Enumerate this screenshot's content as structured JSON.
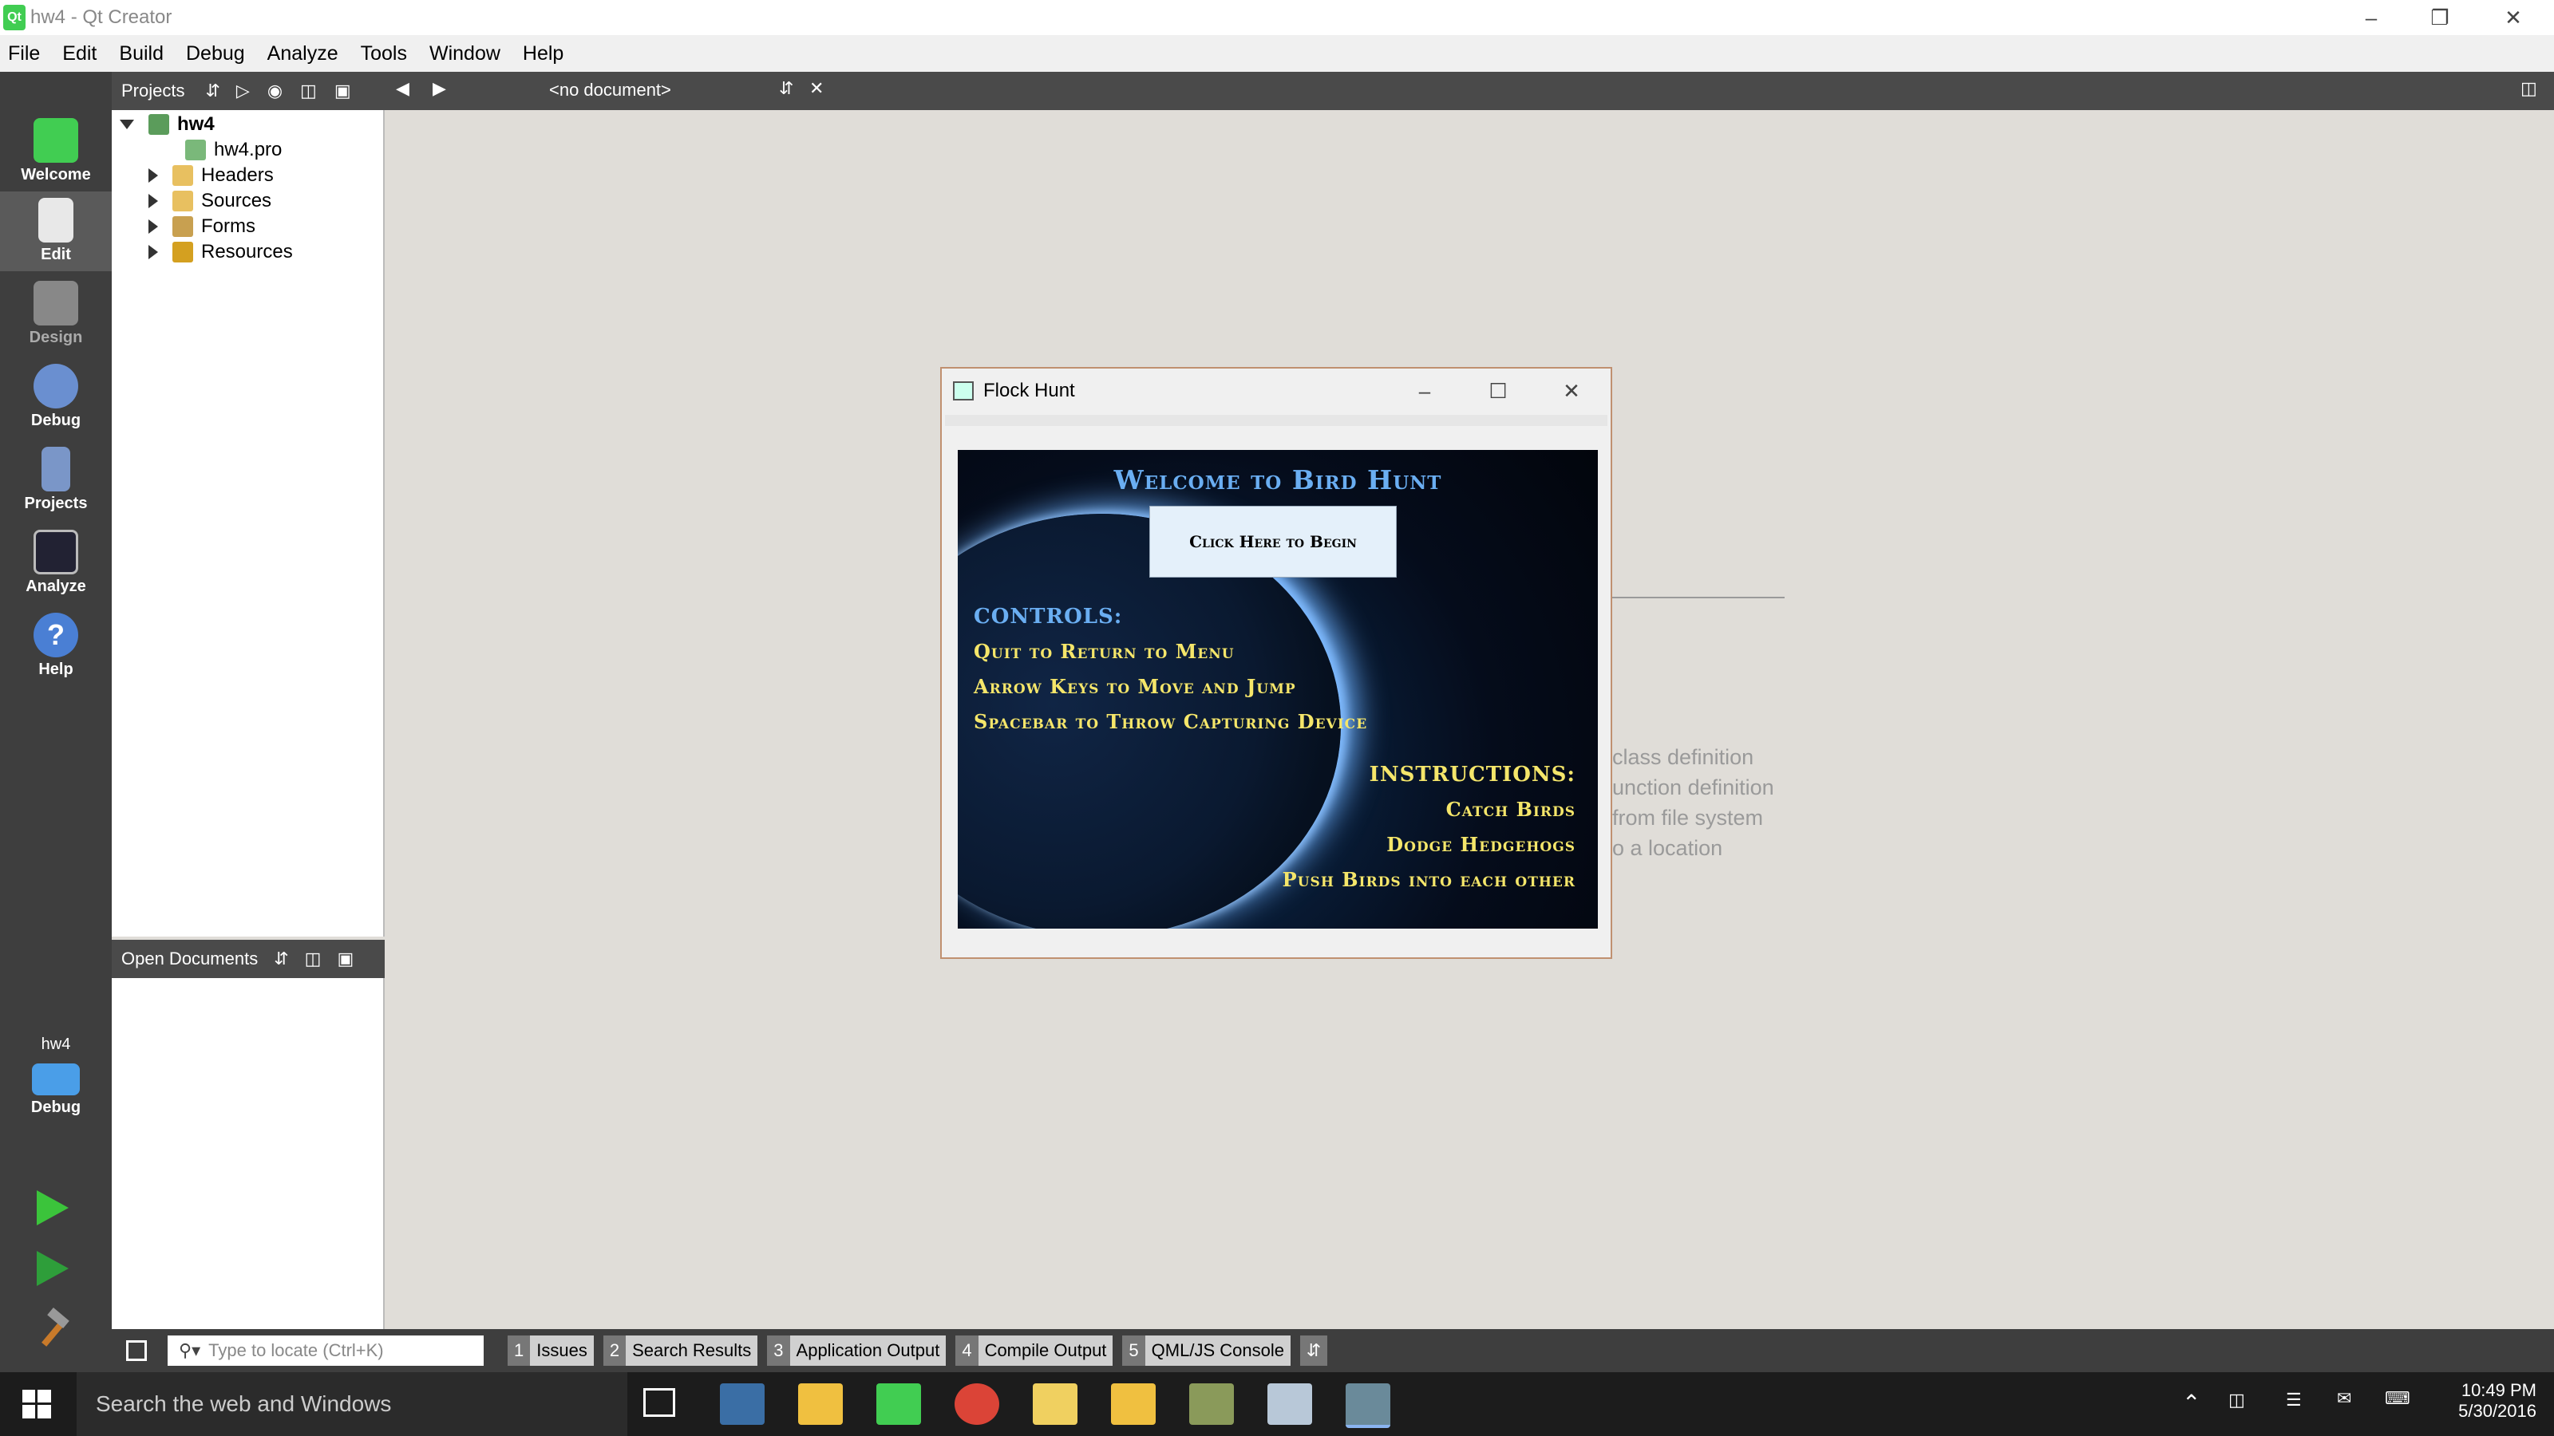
{
  "window": {
    "title": "hw4 - Qt Creator"
  },
  "menu": [
    "File",
    "Edit",
    "Build",
    "Debug",
    "Analyze",
    "Tools",
    "Window",
    "Help"
  ],
  "modes": [
    {
      "label": "Welcome",
      "icon": "qt-logo-icon"
    },
    {
      "label": "Edit",
      "icon": "edit-document-icon"
    },
    {
      "label": "Design",
      "icon": "design-icon"
    },
    {
      "label": "Debug",
      "icon": "debug-icon"
    },
    {
      "label": "Projects",
      "icon": "projects-icon"
    },
    {
      "label": "Analyze",
      "icon": "analyze-icon"
    },
    {
      "label": "Help",
      "icon": "help-icon"
    }
  ],
  "kit": {
    "project": "hw4",
    "build": "Debug"
  },
  "projects_pane": {
    "header": "Projects",
    "root": "hw4",
    "items": [
      "hw4.pro",
      "Headers",
      "Sources",
      "Forms",
      "Resources"
    ]
  },
  "open_documents": {
    "header": "Open Documents"
  },
  "editor": {
    "document": "<no document>"
  },
  "welcome_ghost": [
    "class definition",
    "unction definition",
    "from file system",
    "o a location"
  ],
  "locator": {
    "placeholder": "Type to locate (Ctrl+K)"
  },
  "output_tabs": [
    {
      "num": "1",
      "label": "Issues"
    },
    {
      "num": "2",
      "label": "Search Results"
    },
    {
      "num": "3",
      "label": "Application Output"
    },
    {
      "num": "4",
      "label": "Compile Output"
    },
    {
      "num": "5",
      "label": "QML/JS Console"
    }
  ],
  "game": {
    "window_title": "Flock Hunt",
    "heading": "Welcome to Bird Hunt",
    "button": "Click Here to Begin",
    "controls_title": "CONTROLS:",
    "controls": [
      "Quit to Return to Menu",
      "Arrow Keys to Move and Jump",
      "Spacebar to Throw Capturing Device"
    ],
    "instructions_title": "INSTRUCTIONS:",
    "instructions": [
      "Catch Birds",
      "Dodge Hedgehogs",
      "Push Birds into each other"
    ]
  },
  "taskbar": {
    "search": "Search the web and Windows",
    "time": "10:49 PM",
    "date": "5/30/2016"
  },
  "colors": {
    "qt_green": "#41cd52",
    "game_yellow": "#f5e66a",
    "game_blue": "#5aa8f0"
  }
}
